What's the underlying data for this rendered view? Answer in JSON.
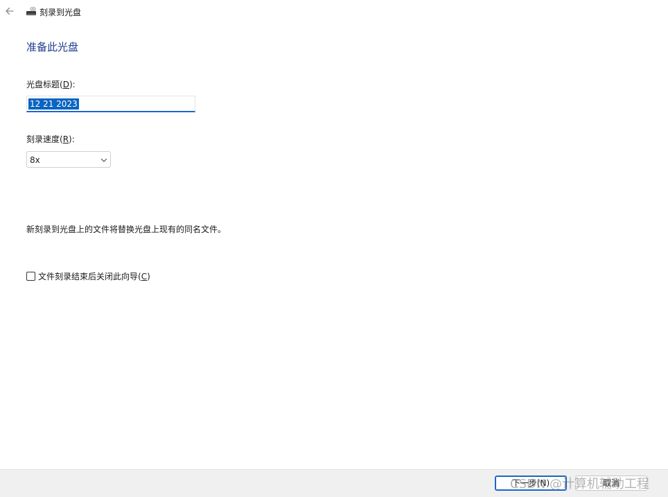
{
  "titlebar": {
    "title": "刻录到光盘",
    "back_icon": "arrow-left-icon",
    "app_icon": "disc-drive-icon"
  },
  "heading": "准备此光盘",
  "disc_title": {
    "label_prefix": "光盘标题(",
    "label_key": "D",
    "label_suffix": "):",
    "value": "12 21 2023"
  },
  "burn_speed": {
    "label_prefix": "刻录速度(",
    "label_key": "R",
    "label_suffix": "):",
    "value": "8x"
  },
  "info_text": "新刻录到光盘上的文件将替换光盘上现有的同名文件。",
  "close_wizard": {
    "label_prefix": "文件刻录结束后关闭此向导(",
    "label_key": "C",
    "label_suffix": ")",
    "checked": false
  },
  "footer": {
    "next_label": "下一步(N)",
    "cancel_label": "取消",
    "watermark": "CSDN @计算机辅助工程"
  },
  "colors": {
    "heading": "#1c3a8c",
    "accent": "#1a66c8",
    "selection": "#0a64c2",
    "footer_bg": "#f0f0f0"
  }
}
